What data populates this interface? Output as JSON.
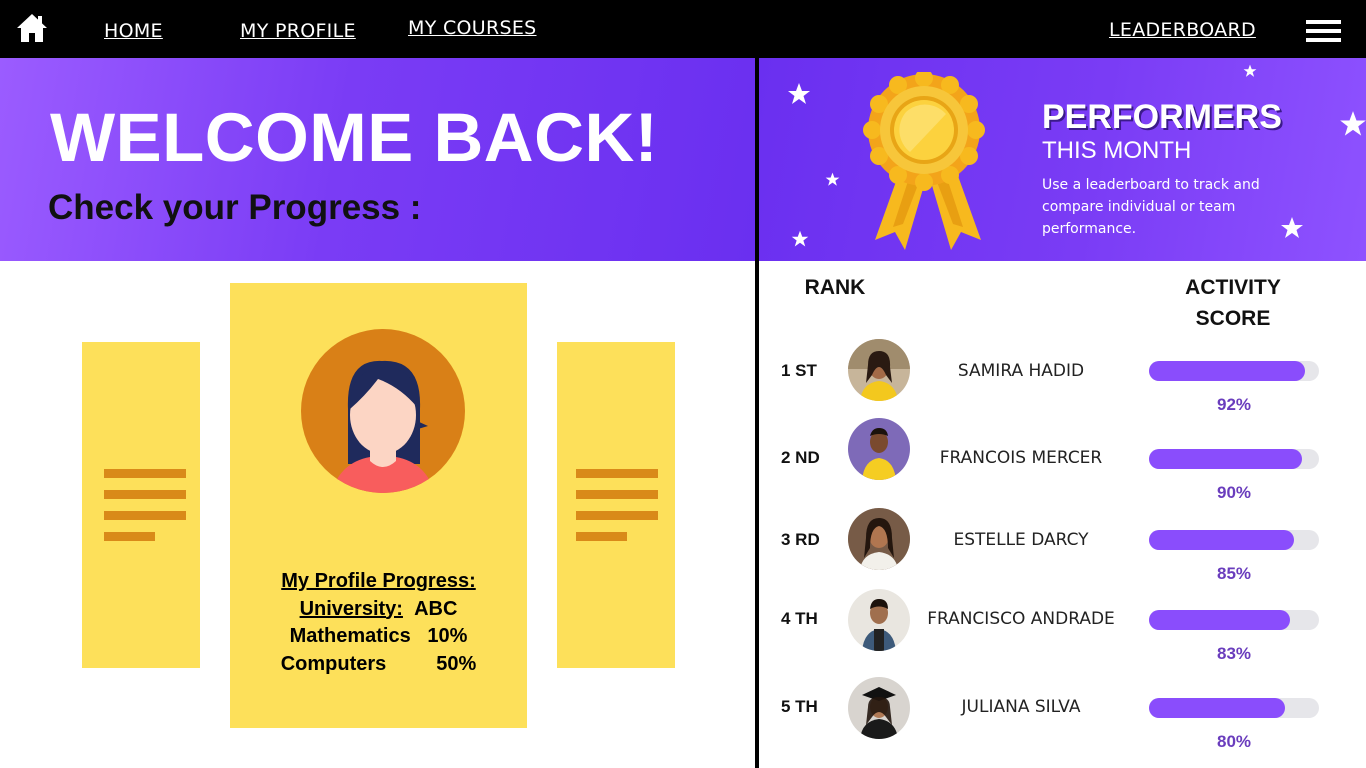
{
  "nav": {
    "home_label": "HOME",
    "profile_label": "MY PROFILE",
    "courses_label": "MY COURSES",
    "leaderboard_label": "LEADERBOARD",
    "home_icon": "home-icon",
    "menu_icon": "hamburger-menu-icon"
  },
  "hero": {
    "title": "WELCOME BACK!",
    "subtitle": "Check your Progress :"
  },
  "performers": {
    "title": "PERFORMERS",
    "subtitle": "THIS MONTH",
    "description": "Use a leaderboard to track and compare individual or team performance.",
    "medal_icon": "award-ribbon-icon"
  },
  "profile_card": {
    "heading": "My Profile Progress:",
    "university_label": "University:",
    "university_value": "ABC",
    "subjects": [
      {
        "name": "Mathematics",
        "value": "10%"
      },
      {
        "name": "Computers",
        "value": "50%"
      }
    ]
  },
  "leaderboard": {
    "rank_header": "RANK",
    "score_header_line1": "ACTIVITY",
    "score_header_line2": "SCORE",
    "entries": [
      {
        "rank": "1 ST",
        "name": "SAMIRA HADID",
        "score": "92%",
        "fraction": 0.92
      },
      {
        "rank": "2 ND",
        "name": "FRANCOIS MERCER",
        "score": "90%",
        "fraction": 0.9
      },
      {
        "rank": "3 RD",
        "name": "ESTELLE DARCY",
        "score": "85%",
        "fraction": 0.85
      },
      {
        "rank": "4 TH",
        "name": "FRANCISCO ANDRADE",
        "score": "83%",
        "fraction": 0.83
      },
      {
        "rank": "5 TH",
        "name": "JULIANA SILVA",
        "score": "80%",
        "fraction": 0.8
      }
    ]
  },
  "colors": {
    "accent_purple": "#8a4dfc",
    "card_yellow": "#fde05a",
    "card_lines": "#d98a19",
    "nav_bg": "#000000"
  }
}
